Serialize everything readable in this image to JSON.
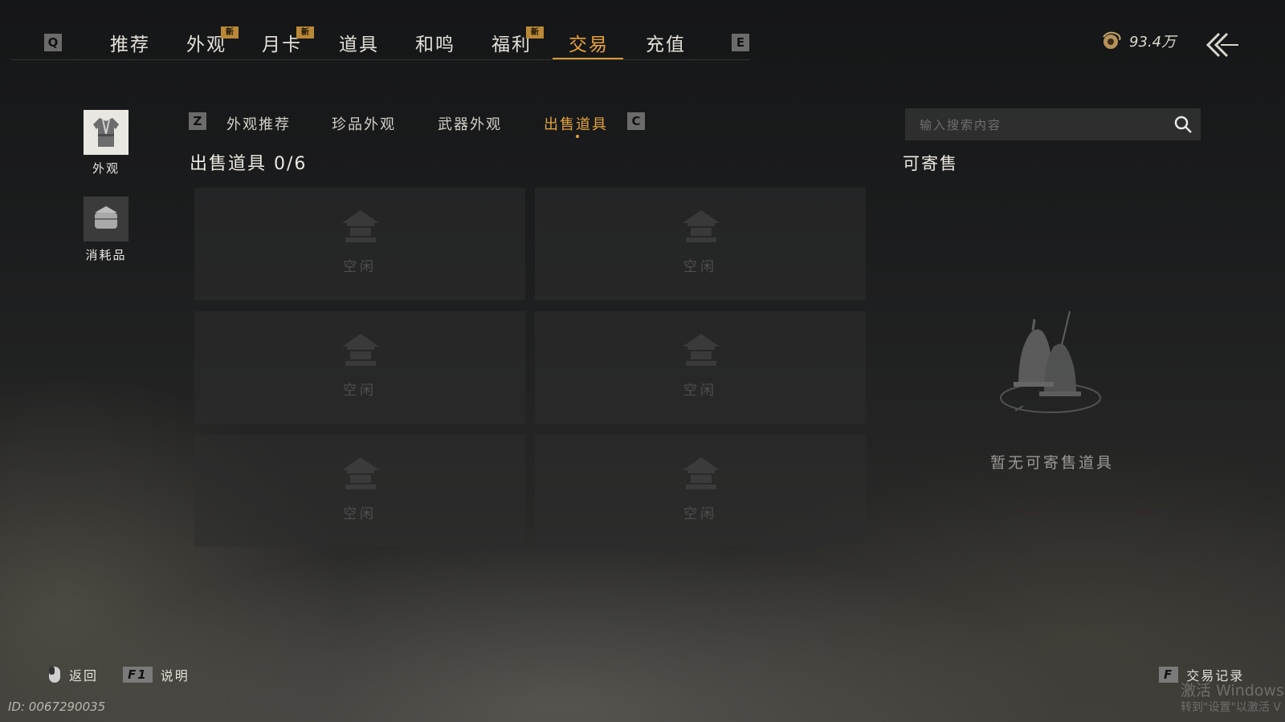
{
  "top_nav": {
    "left_key": "Q",
    "right_key": "E",
    "tabs": [
      {
        "label": "推荐"
      },
      {
        "label": "外观",
        "badge": "新"
      },
      {
        "label": "月卡",
        "badge": "新"
      },
      {
        "label": "道具"
      },
      {
        "label": "和鸣"
      },
      {
        "label": "福利",
        "badge": "新"
      },
      {
        "label": "交易"
      },
      {
        "label": "充值"
      }
    ],
    "active_tab": "交易",
    "currency": {
      "value": "93.4万",
      "icon": "coin-icon"
    },
    "accent_color": "#e2a341"
  },
  "categories": [
    {
      "label": "外观",
      "icon": "robe-icon",
      "selected": true
    },
    {
      "label": "消耗品",
      "icon": "package-icon",
      "selected": false
    }
  ],
  "sub_nav": {
    "left_key": "Z",
    "right_key": "C",
    "tabs": [
      {
        "label": "外观推荐"
      },
      {
        "label": "珍品外观"
      },
      {
        "label": "武器外观"
      },
      {
        "label": "出售道具"
      }
    ],
    "active_tab": "出售道具"
  },
  "sell_section": {
    "title": "出售道具 0/6",
    "slots": [
      {
        "status": "空闲"
      },
      {
        "status": "空闲"
      },
      {
        "status": "空闲"
      },
      {
        "status": "空闲"
      },
      {
        "status": "空闲"
      },
      {
        "status": "空闲"
      }
    ]
  },
  "right_panel": {
    "search_placeholder": "输入搜索内容",
    "title": "可寄售",
    "empty_text": "暂无可寄售道具",
    "empty_icon": "bells-icon"
  },
  "footer": {
    "back": {
      "label": "返回",
      "icon": "mouse-icon"
    },
    "help": {
      "key": "F1",
      "label": "说明"
    },
    "history": {
      "key": "F",
      "label": "交易记录"
    },
    "id_text": "ID: 0067290035",
    "watermark_line1": "激活 Windows",
    "watermark_line2": "转到\"设置\"以激活 V"
  }
}
